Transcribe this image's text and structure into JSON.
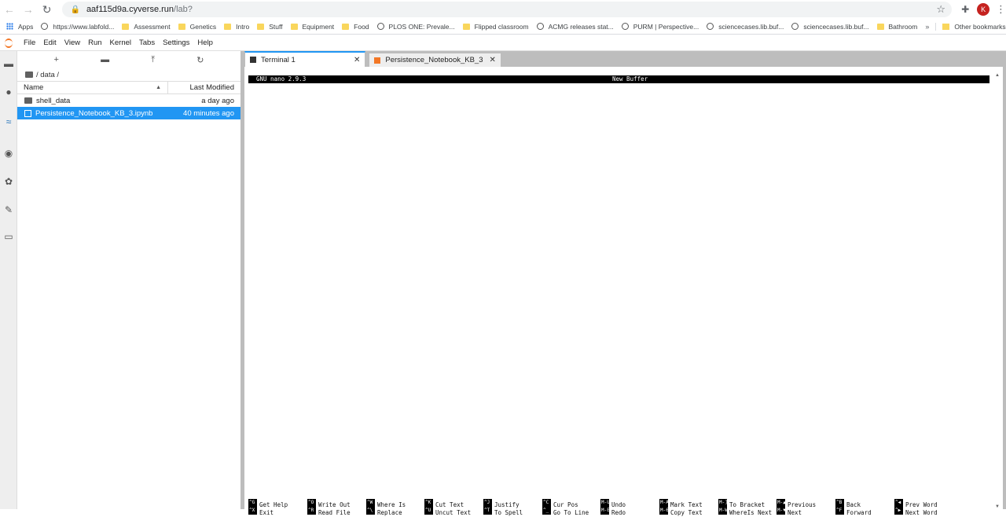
{
  "browser": {
    "url_host": "aaf115d9a.cyverse.run",
    "url_path": "/lab?",
    "profile_initial": "K",
    "bookmarks": [
      {
        "label": "Apps",
        "icon": "apps-grid-icon"
      },
      {
        "label": "https://www.labfold...",
        "icon": "globe-icon"
      },
      {
        "label": "Assessment",
        "icon": "folder-icon"
      },
      {
        "label": "Genetics",
        "icon": "folder-icon"
      },
      {
        "label": "Intro",
        "icon": "folder-icon"
      },
      {
        "label": "Stuff",
        "icon": "folder-icon"
      },
      {
        "label": "Equipment",
        "icon": "folder-icon"
      },
      {
        "label": "Food",
        "icon": "folder-icon"
      },
      {
        "label": "PLOS ONE: Prevale...",
        "icon": "plos-icon"
      },
      {
        "label": "Flipped classroom",
        "icon": "folder-icon"
      },
      {
        "label": "ACMG releases stat...",
        "icon": "acmg-icon"
      },
      {
        "label": "PURM | Perspective...",
        "icon": "globe-icon"
      },
      {
        "label": "sciencecases.lib.buf...",
        "icon": "globe-icon"
      },
      {
        "label": "sciencecases.lib.buf...",
        "icon": "globe-icon"
      },
      {
        "label": "Bathroom",
        "icon": "folder-icon"
      }
    ],
    "more": "»",
    "other_bookmarks": "Other bookmarks"
  },
  "menubar": [
    "File",
    "Edit",
    "View",
    "Run",
    "Kernel",
    "Tabs",
    "Settings",
    "Help"
  ],
  "filebrowser": {
    "breadcrumb": "/ data /",
    "col_name": "Name",
    "col_modified": "Last Modified",
    "files": [
      {
        "name": "shell_data",
        "modified": "a day ago",
        "type": "folder",
        "selected": false
      },
      {
        "name": "Persistence_Notebook_KB_3.ipynb",
        "modified": "40 minutes ago",
        "type": "notebook",
        "selected": true
      }
    ]
  },
  "tabs": [
    {
      "label": "Terminal 1",
      "active": true,
      "icon": "terminal-icon"
    },
    {
      "label": "Persistence_Notebook_KB_3",
      "active": false,
      "icon": "notebook-icon"
    }
  ],
  "nano": {
    "version": "GNU nano 2.9.3",
    "buffer": "New Buffer",
    "shortcuts_row1": [
      {
        "key": "^G",
        "label": "Get Help"
      },
      {
        "key": "^O",
        "label": "Write Out"
      },
      {
        "key": "^W",
        "label": "Where Is"
      },
      {
        "key": "^K",
        "label": "Cut Text"
      },
      {
        "key": "^J",
        "label": "Justify"
      },
      {
        "key": "^C",
        "label": "Cur Pos"
      },
      {
        "key": "M-U",
        "label": "Undo"
      },
      {
        "key": "M-A",
        "label": "Mark Text"
      },
      {
        "key": "M-]",
        "label": "To Bracket"
      },
      {
        "key": "M-▲",
        "label": "Previous"
      },
      {
        "key": "^B",
        "label": "Back"
      },
      {
        "key": "^◀",
        "label": "Prev Word"
      }
    ],
    "shortcuts_row2": [
      {
        "key": "^X",
        "label": "Exit"
      },
      {
        "key": "^R",
        "label": "Read File"
      },
      {
        "key": "^\\",
        "label": "Replace"
      },
      {
        "key": "^U",
        "label": "Uncut Text"
      },
      {
        "key": "^T",
        "label": "To Spell"
      },
      {
        "key": "^_",
        "label": "Go To Line"
      },
      {
        "key": "M-E",
        "label": "Redo"
      },
      {
        "key": "M-6",
        "label": "Copy Text"
      },
      {
        "key": "M-W",
        "label": "WhereIs Next"
      },
      {
        "key": "M-▼",
        "label": "Next"
      },
      {
        "key": "^F",
        "label": "Forward"
      },
      {
        "key": "^▶",
        "label": "Next Word"
      }
    ]
  }
}
